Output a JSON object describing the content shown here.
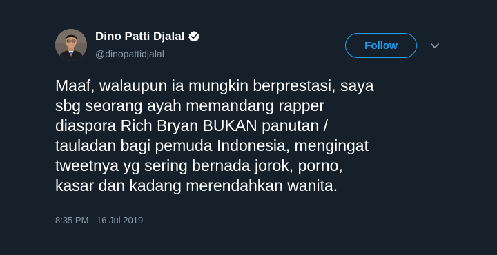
{
  "author": {
    "name": "Dino Patti Djalal",
    "handle": "@dinopattidjalal",
    "verified_icon": "verified-badge-icon",
    "avatar_icon": "profile-photo"
  },
  "follow_button": {
    "label": "Follow"
  },
  "menu": {
    "icon": "chevron-down-icon"
  },
  "tweet": {
    "lines": [
      "Maaf, walaupun ia mungkin berprestasi, saya",
      "sbg seorang ayah memandang rapper",
      "diaspora Rich Bryan BUKAN panutan /",
      "tauladan bagi pemuda Indonesia, mengingat",
      "tweetnya yg sering bernada jorok, porno,",
      "kasar dan kadang merendahkan wanita."
    ],
    "timestamp": "8:35 PM - 16 Jul 2019"
  },
  "colors": {
    "background": "#15202b",
    "text": "#ffffff",
    "secondary_text": "#8899a6",
    "accent": "#1da1f2"
  }
}
